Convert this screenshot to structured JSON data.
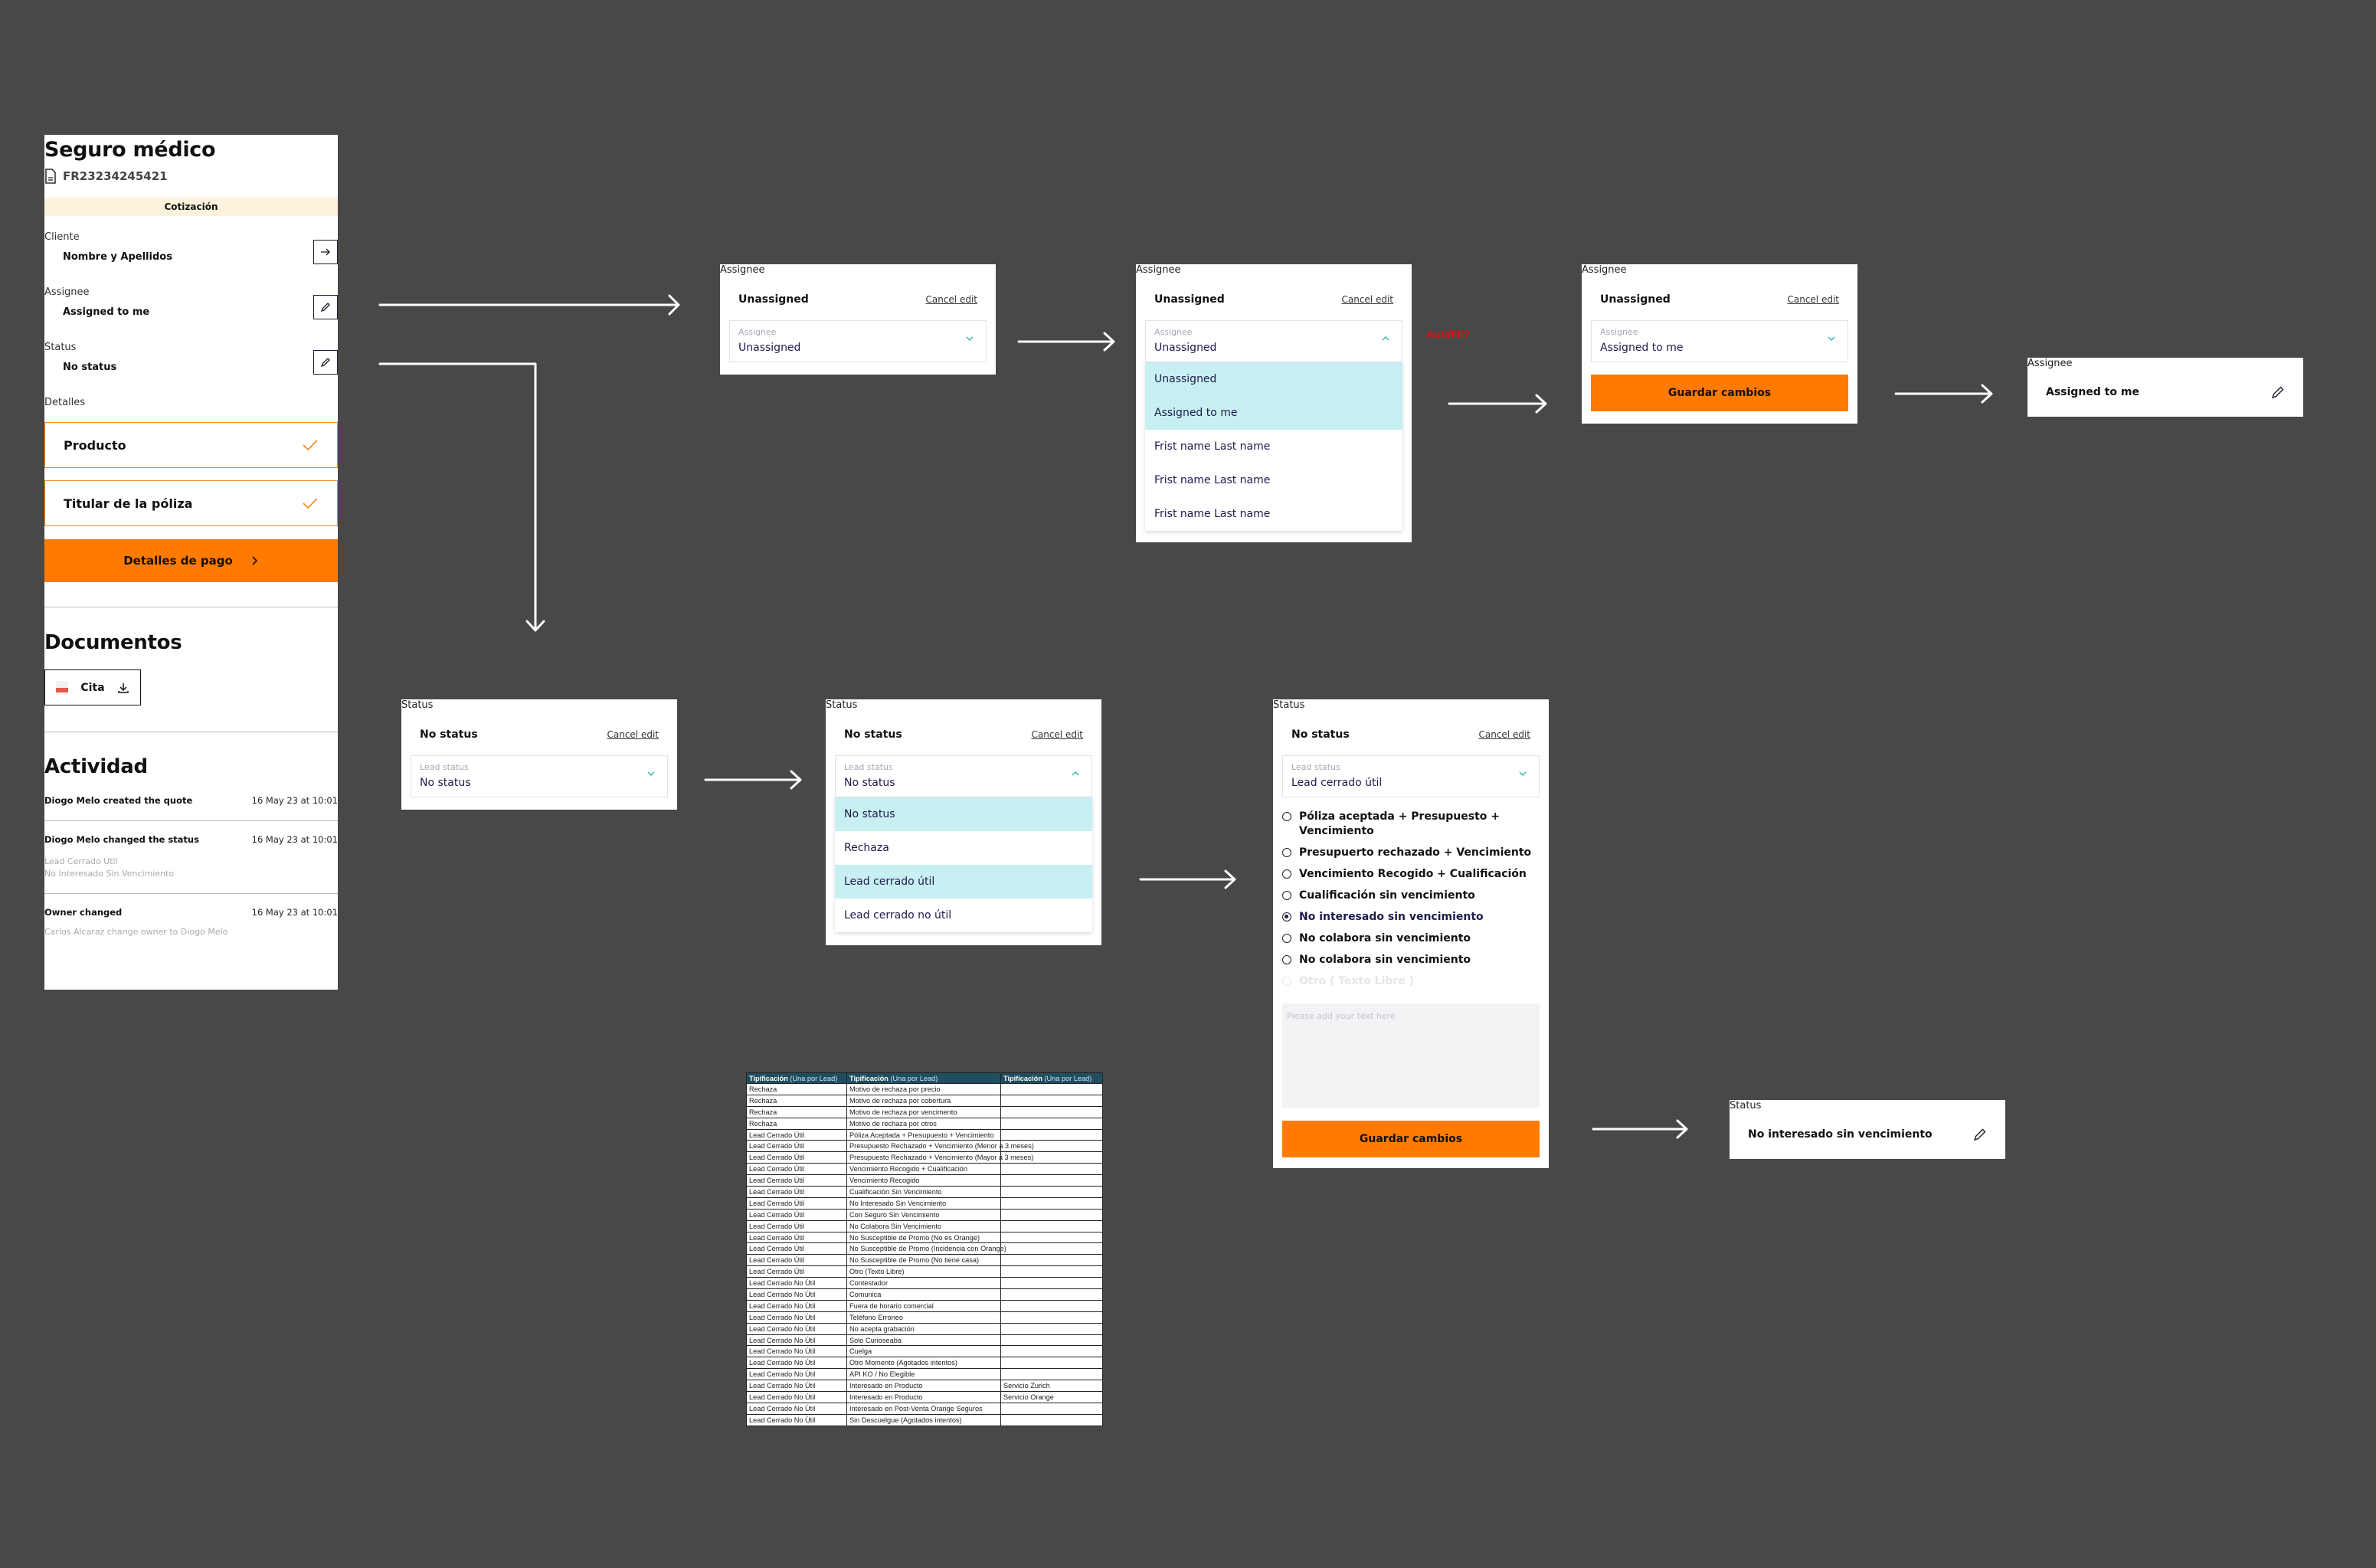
{
  "main_panel": {
    "title": "Seguro médico",
    "policy_id": "FR23234245421",
    "stage_badge": "Cotización",
    "client_label": "Cliente",
    "client_value": "Nombre y Apellidos",
    "assignee_label": "Assignee",
    "assignee_value": "Assigned to me",
    "status_label": "Status",
    "status_value": "No status",
    "details_label": "Detalles",
    "details": [
      {
        "label": "Producto",
        "icon": "check-icon"
      },
      {
        "label": "Titular de la póliza",
        "icon": "check-icon"
      }
    ],
    "payment_button": "Detalles de pago",
    "documents_title": "Documentos",
    "document_chip": "Cita",
    "activity_title": "Actividad",
    "activity": [
      {
        "title": "Diogo Melo created the quote",
        "time": "16 May 23 at 10:01",
        "sub": []
      },
      {
        "title": "Diogo Melo changed the status",
        "time": "16 May 23 at 10:01",
        "sub": [
          "Lead Cerrado Útil",
          "No Interesado Sin Vencimiento"
        ]
      },
      {
        "title": "Owner changed",
        "time": "16 May 23 at 10:01",
        "sub": [
          "Carlos Alcaraz change owner to Diogo Melo"
        ]
      }
    ]
  },
  "assignee_flow": {
    "step1": {
      "heading": "Assignee",
      "current": "Unassigned",
      "cancel": "Cancel edit",
      "field_label": "Assignee",
      "field_value": "Unassigned"
    },
    "step2": {
      "heading": "Assignee",
      "current": "Unassigned",
      "cancel": "Cancel edit",
      "field_label": "Assignee",
      "field_value": "Unassigned",
      "options": [
        "Unassigned",
        "Assigned to me",
        "Frist name Last name",
        "Frist name Last name",
        "Frist name Last name"
      ],
      "highlighted": [
        "Unassigned",
        "Assigned to me"
      ]
    },
    "note": "Autofill?",
    "step3": {
      "heading": "Assignee",
      "current": "Unassigned",
      "cancel": "Cancel edit",
      "field_label": "Assignee",
      "field_value": "Assigned to me",
      "save": "Guardar cambios"
    },
    "result": {
      "heading": "Assignee",
      "value": "Assigned to me"
    }
  },
  "status_flow": {
    "step1": {
      "heading": "Status",
      "current": "No status",
      "cancel": "Cancel edit",
      "field_label": "Lead status",
      "field_value": "No status"
    },
    "step2": {
      "heading": "Status",
      "current": "No status",
      "cancel": "Cancel edit",
      "field_label": "Lead status",
      "field_value": "No status",
      "options": [
        "No status",
        "Rechaza",
        "Lead cerrado útil",
        "Lead cerrado no útil"
      ],
      "highlighted": [
        "No status",
        "Lead cerrado útil"
      ]
    },
    "step3": {
      "heading": "Status",
      "current": "No status",
      "cancel": "Cancel edit",
      "field_label": "Lead status",
      "field_value": "Lead cerrado útil",
      "reasons": [
        {
          "label": "Póliza aceptada + Presupuesto + Vencimiento",
          "state": "unchecked"
        },
        {
          "label": "Presupuerto rechazado + Vencimiento",
          "state": "unchecked"
        },
        {
          "label": "Vencimiento Recogido + Cualificación",
          "state": "unchecked"
        },
        {
          "label": "Cualificación sin vencimiento",
          "state": "unchecked"
        },
        {
          "label": "No interesado sin vencimiento",
          "state": "checked"
        },
        {
          "label": "No colabora sin vencimiento",
          "state": "unchecked"
        },
        {
          "label": "No colabora sin vencimiento",
          "state": "unchecked"
        },
        {
          "label": "Otro ( Texto Libre )",
          "state": "disabled"
        }
      ],
      "free_text_placeholder": "Please add your text here",
      "save": "Guardar cambios"
    },
    "result": {
      "heading": "Status",
      "value": "No interesado sin vencimiento"
    }
  },
  "tipificacion_table": {
    "headers": [
      {
        "main": "Tipificación",
        "sub": "(Una por Lead)"
      },
      {
        "main": "Tipificación",
        "sub": "(Una por Lead)"
      },
      {
        "main": "Tipificación",
        "sub": "(Una por Lead)"
      }
    ],
    "rows": [
      [
        "Rechaza",
        "Motivo de rechaza por precio",
        ""
      ],
      [
        "Rechaza",
        "Motivo de rechaza por cobertura",
        ""
      ],
      [
        "Rechaza",
        "Motivo de rechaza por vencimento",
        ""
      ],
      [
        "Rechaza",
        "Motivo de rechaza por otros",
        ""
      ],
      [
        "Lead Cerrado Útil",
        "Póliza Aceptada + Presupuesto + Vencimiento",
        ""
      ],
      [
        "Lead Cerrado Útil",
        "Presupuesto Rechazado + Vencimiento (Menor a 3 meses)",
        ""
      ],
      [
        "Lead Cerrado Útil",
        "Presupuesto Rechazado + Vencimiento (Mayor a 3 meses)",
        ""
      ],
      [
        "Lead Cerrado Útil",
        "Vencimiento Recogido + Cualificación",
        ""
      ],
      [
        "Lead Cerrado Útil",
        "Vencimiento Recogido",
        ""
      ],
      [
        "Lead Cerrado Útil",
        "Cualificación Sin Vencimiento",
        ""
      ],
      [
        "Lead Cerrado Útil",
        "No Interesado Sin Vencimiento",
        ""
      ],
      [
        "Lead Cerrado Útil",
        "Con Seguro Sin Vencimiento",
        ""
      ],
      [
        "Lead Cerrado Útil",
        "No Colabora Sin Vencimiento",
        ""
      ],
      [
        "Lead Cerrado Útil",
        "No Susceptible de Promo (No es Orange)",
        ""
      ],
      [
        "Lead Cerrado Útil",
        "No Susceptible de Promo (Incidencia con Orange)",
        ""
      ],
      [
        "Lead Cerrado Útil",
        "No Susceptible de Promo (No tiene casa)",
        ""
      ],
      [
        "Lead Cerrado Útil",
        "Otro (Texto Libre)",
        ""
      ],
      [
        "Lead Cerrado No Útil",
        "Contestador",
        ""
      ],
      [
        "Lead Cerrado No Útil",
        "Comunica",
        ""
      ],
      [
        "Lead Cerrado No Útil",
        "Fuera de horario comercial",
        ""
      ],
      [
        "Lead Cerrado No Útil",
        "Teléfono Erroneo",
        ""
      ],
      [
        "Lead Cerrado No Útil",
        "No acepta grabación",
        ""
      ],
      [
        "Lead Cerrado No Útil",
        "Solo Curioseaba",
        ""
      ],
      [
        "Lead Cerrado No Útil",
        "Cuelga",
        ""
      ],
      [
        "Lead Cerrado No Útil",
        "Otro Momento (Agotados intentos)",
        ""
      ],
      [
        "Lead Cerrado No Útil",
        "API KO / No Elegible",
        ""
      ],
      [
        "Lead Cerrado No Útil",
        "Interesado en Producto",
        "Servicio Zurich"
      ],
      [
        "Lead Cerrado No Útil",
        "Interesado en Producto",
        "Servicio Orange"
      ],
      [
        "Lead Cerrado No Útil",
        "Interesado en Post-Venta Orange Seguros",
        ""
      ],
      [
        "Lead Cerrado No Útil",
        "Sin Descuelgue (Agotados intentos)",
        ""
      ]
    ]
  },
  "colors": {
    "canvas": "#484848",
    "accent_orange": "#ff7a00",
    "stage_badge_bg": "#fdf3dc",
    "detail_border": "#f08a24",
    "dropdown_highlight": "#c8eff2",
    "chevron_teal": "#2bb5b5",
    "table_header": "#1f4e5f",
    "note_red": "#e01010"
  }
}
